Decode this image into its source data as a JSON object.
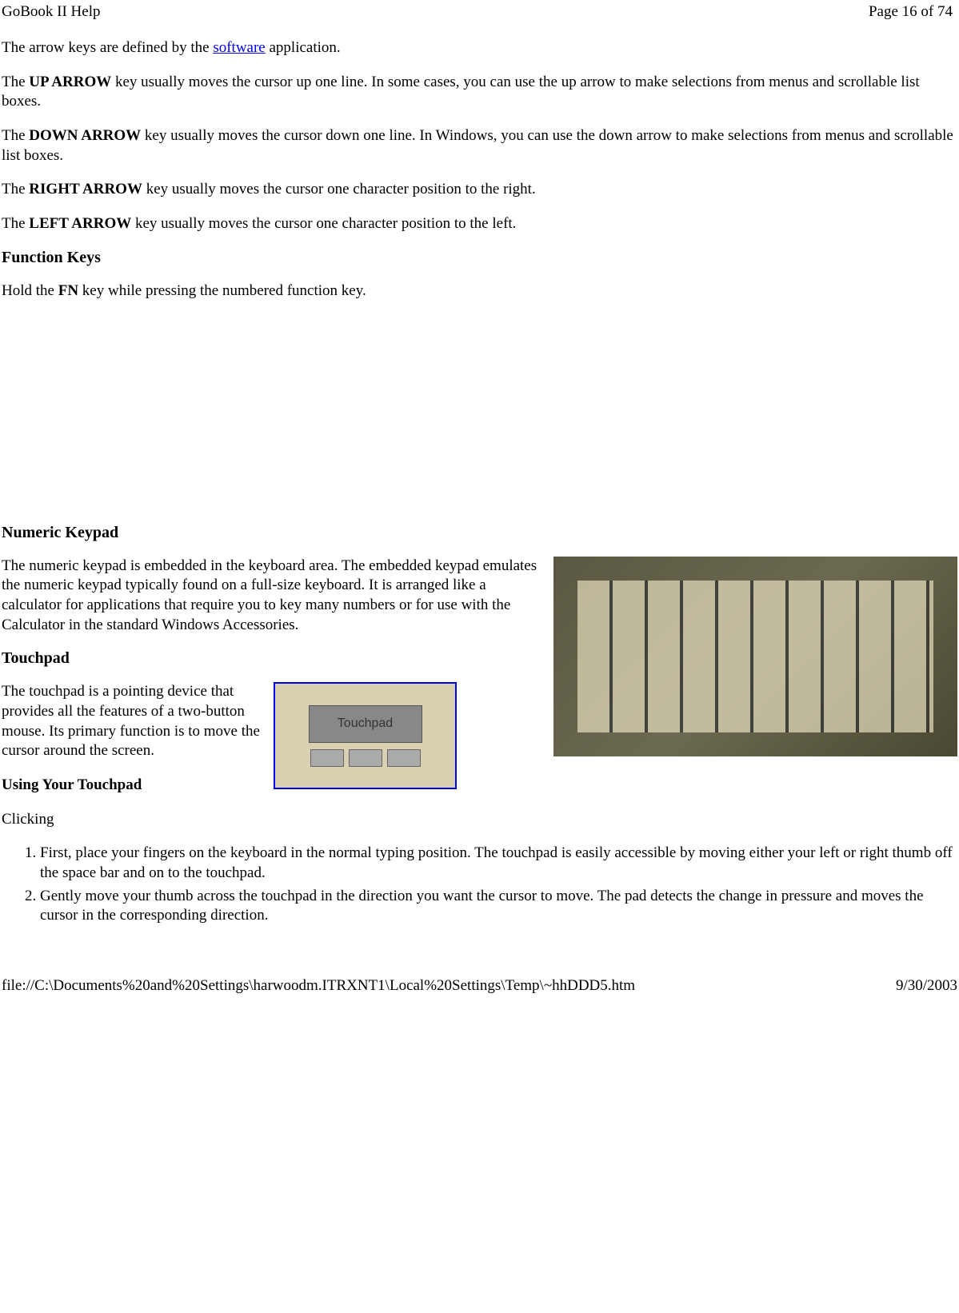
{
  "header": {
    "title": "GoBook II Help",
    "page_indicator": "Page 16 of 74"
  },
  "intro": {
    "prefix": "The arrow keys are defined by the ",
    "link": "software",
    "suffix": " application."
  },
  "arrows": {
    "up": {
      "label": "UP ARROW",
      "prefix": "The ",
      "text": " key usually moves the cursor up one line. In some cases, you can use the up arrow to make selections from menus and scrollable list boxes."
    },
    "down": {
      "label": "DOWN ARROW",
      "prefix": "The ",
      "text": " key usually moves the cursor down one line. In Windows, you can use the down arrow to make selections from menus and scrollable list boxes."
    },
    "right": {
      "label": "RIGHT ARROW",
      "prefix": "The ",
      "text": " key usually moves the cursor one character position to the right."
    },
    "left": {
      "label": "LEFT ARROW",
      "prefix": "The ",
      "text": " key usually moves the cursor one character position to the left."
    }
  },
  "function_keys": {
    "heading": "Function Keys",
    "prefix": "Hold the ",
    "label": "FN",
    "text": " key while pressing the numbered function key."
  },
  "numeric": {
    "heading": "Numeric Keypad",
    "text": "The numeric keypad is embedded in the keyboard area.   The embedded keypad emulates the numeric keypad typically found on a full-size keyboard.   It is arranged like a calculator for applications that require you to key many numbers or for use with the Calculator in the standard Windows Accessories."
  },
  "touchpad": {
    "heading": "Touchpad",
    "text": "The touchpad  is a pointing device that provides all the features of a two-button mouse. Its primary function is to move the cursor around the screen.",
    "img_label": "Touchpad",
    "using_heading": "Using Your Touchpad",
    "clicking_heading": "Clicking",
    "steps": [
      "First, place your fingers on the keyboard in the normal typing position. The touchpad is easily accessible by moving either your left or right thumb off the space bar and on to the touchpad.",
      "Gently move your thumb across the touchpad in the direction you want the cursor to move. The pad detects the change in pressure and moves the cursor in the corresponding direction."
    ]
  },
  "footer": {
    "path": "file://C:\\Documents%20and%20Settings\\harwoodm.ITRXNT1\\Local%20Settings\\Temp\\~hhDDD5.htm",
    "date": "9/30/2003"
  }
}
